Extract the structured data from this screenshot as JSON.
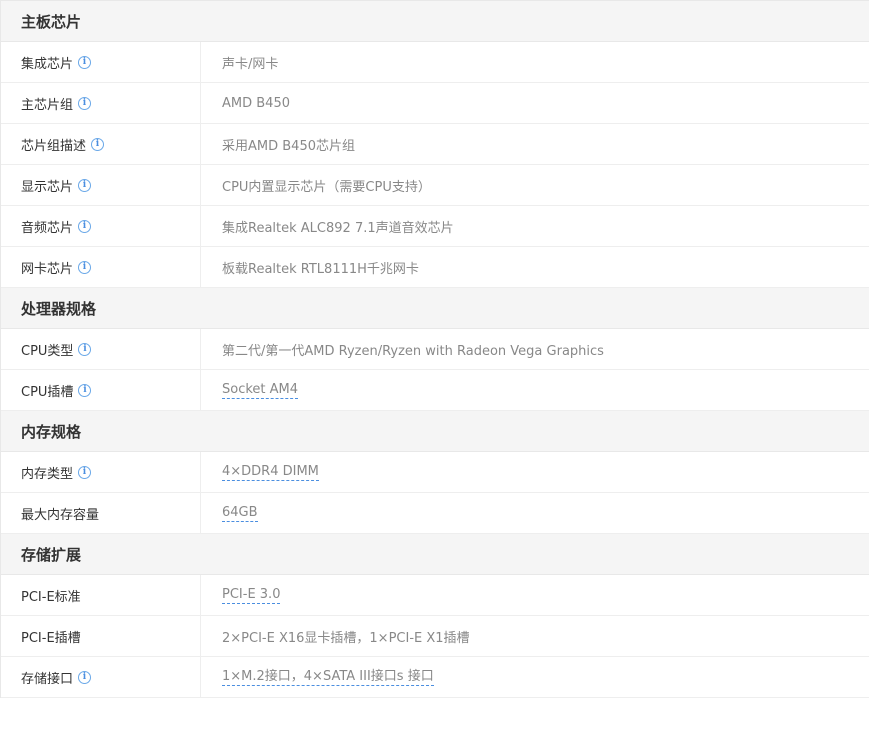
{
  "sections": [
    {
      "title": "主板芯片",
      "rows": [
        {
          "label": "集成芯片",
          "value": "声卡/网卡"
        },
        {
          "label": "主芯片组",
          "value": "AMD B450"
        },
        {
          "label": "芯片组描述",
          "value": "采用AMD B450芯片组"
        },
        {
          "label": "显示芯片",
          "value": "CPU内置显示芯片（需要CPU支持）"
        },
        {
          "label": "音频芯片",
          "value": "集成Realtek ALC892 7.1声道音效芯片"
        },
        {
          "label": "网卡芯片",
          "value": "板载Realtek RTL8111H千兆网卡"
        }
      ]
    },
    {
      "title": "处理器规格",
      "rows": [
        {
          "label": "CPU类型",
          "value": "第二代/第一代AMD Ryzen/Ryzen with Radeon Vega Graphics"
        },
        {
          "label": "CPU插槽",
          "value": "Socket AM4"
        }
      ]
    },
    {
      "title": "内存规格",
      "rows": [
        {
          "label": "内存类型",
          "value": "4×DDR4 DIMM"
        },
        {
          "label": "最大内存容量",
          "value": "64GB"
        }
      ]
    },
    {
      "title": "存储扩展",
      "rows": [
        {
          "label": "PCI-E标准",
          "value": "PCI-E 3.0"
        },
        {
          "label": "PCI-E插槽",
          "value": "2×PCI-E X16显卡插槽，1×PCI-E X1插槽"
        },
        {
          "label": "存储接口",
          "value": "1×M.2接口，4×SATA III接口s 接口"
        }
      ]
    }
  ],
  "info_icon_glyph": "i",
  "colors": {
    "link_underline": "#4a8ee0",
    "section_bg": "#f5f5f5"
  }
}
